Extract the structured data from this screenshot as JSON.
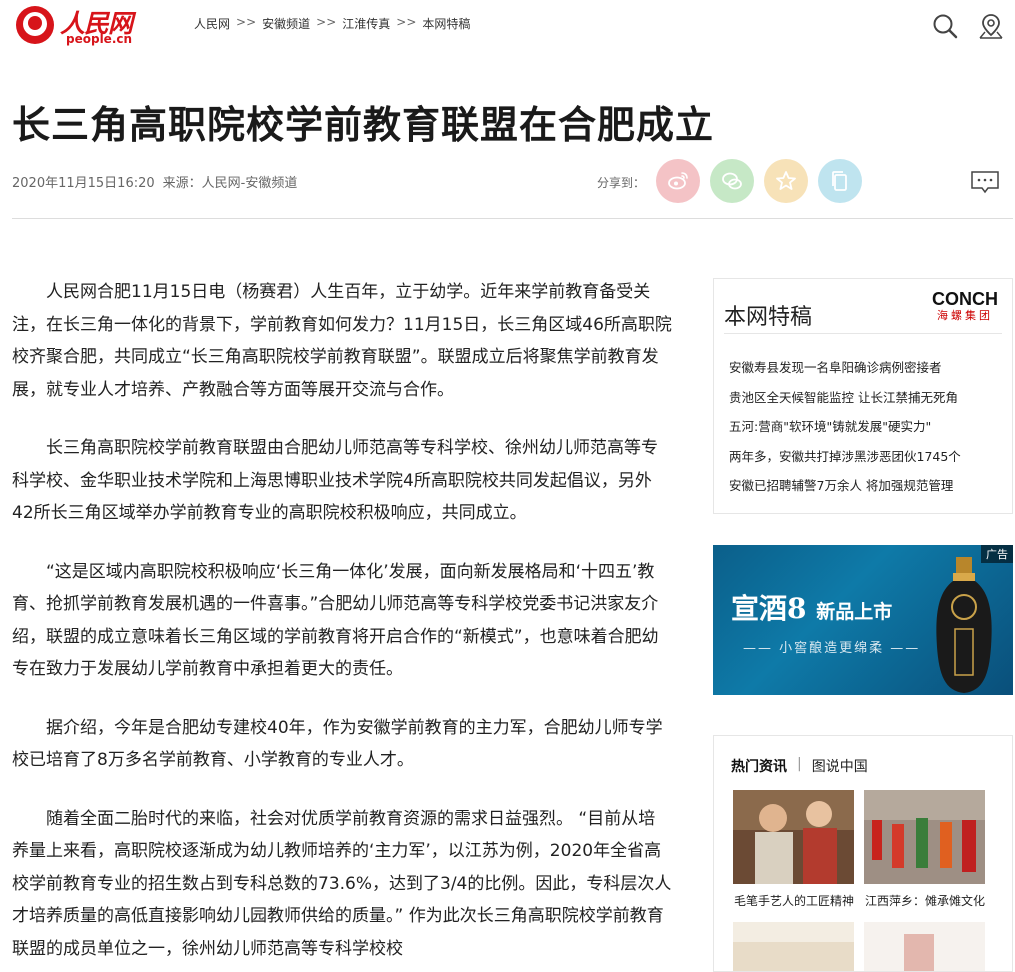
{
  "header": {
    "logo_cn": "人民网",
    "logo_en": "people.cn",
    "breadcrumb": [
      "人民网",
      "安徽频道",
      "江淮传真",
      "本网特稿"
    ],
    "breadcrumb_sep": ">>"
  },
  "article": {
    "title": "长三角高职院校学前教育联盟在合肥成立",
    "date": "2020年11月15日16:20",
    "source": "来源：人民网-安徽频道",
    "share_label": "分享到：",
    "paragraphs": [
      "人民网合肥11月15日电（杨赛君）人生百年，立于幼学。近年来学前教育备受关注，在长三角一体化的背景下，学前教育如何发力？11月15日，长三角区域46所高职院校齐聚合肥，共同成立“长三角高职院校学前教育联盟”。联盟成立后将聚焦学前教育发展，就专业人才培养、产教融合等方面等展开交流与合作。",
      "长三角高职院校学前教育联盟由合肥幼儿师范高等专科学校、徐州幼儿师范高等专科学校、金华职业技术学院和上海思博职业技术学院4所高职院校共同发起倡议，另外42所长三角区域举办学前教育专业的高职院校积极响应，共同成立。",
      "“这是区域内高职院校积极响应‘长三角一体化’发展，面向新发展格局和‘十四五’教育、抢抓学前教育发展机遇的一件喜事。”合肥幼儿师范高等专科学校党委书记洪家友介绍，联盟的成立意味着长三角区域的学前教育将开启合作的“新模式”，也意味着合肥幼专在致力于发展幼儿学前教育中承担着更大的责任。",
      "据介绍，今年是合肥幼专建校40年，作为安徽学前教育的主力军，合肥幼儿师专学校已培育了8万多名学前教育、小学教育的专业人才。",
      "随着全面二胎时代的来临，社会对优质学前教育资源的需求日益强烈。 “目前从培养量上来看，高职院校逐渐成为幼儿教师培养的‘主力军’，以江苏为例，2020年全省高校学前教育专业的招生数占到专科总数的73.6%，达到了3/4的比例。因此，专科层次人才培养质量的高低直接影响幼儿园教师供给的质量。” 作为此次长三角高职院校学前教育联盟的成员单位之一，徐州幼儿师范高等专科学校校"
    ]
  },
  "sidebar": {
    "special_title": "本网特稿",
    "brand_name": "CONCH",
    "brand_cn": "海螺集团",
    "special_items": [
      "安徽寿县发现一名阜阳确诊病例密接者",
      "贵池区全天候智能监控 让长江禁捕无死角",
      "五河:营商\"软环境\"铸就发展\"硬实力\"",
      "两年多，安徽共打掉涉黑涉恶团伙1745个",
      "安徽已招聘辅警7万余人 将加强规范管理"
    ],
    "ad": {
      "tag": "广告",
      "headline_main": "宣酒8",
      "headline_sub": "新品上市",
      "slogan": "—— 小窖酿造更绵柔 ——"
    },
    "hot_tabs": [
      "热门资讯",
      "图说中国"
    ],
    "hot_captions": [
      "毛笔手艺人的工匠精神",
      "江西萍乡：傩承傩文化"
    ]
  },
  "colors": {
    "brand_red": "#d7141a",
    "weibo": "#f4c3c6",
    "wechat": "#c6e8c6",
    "favorite": "#f7e2b8",
    "copy": "#bfe4ef"
  }
}
